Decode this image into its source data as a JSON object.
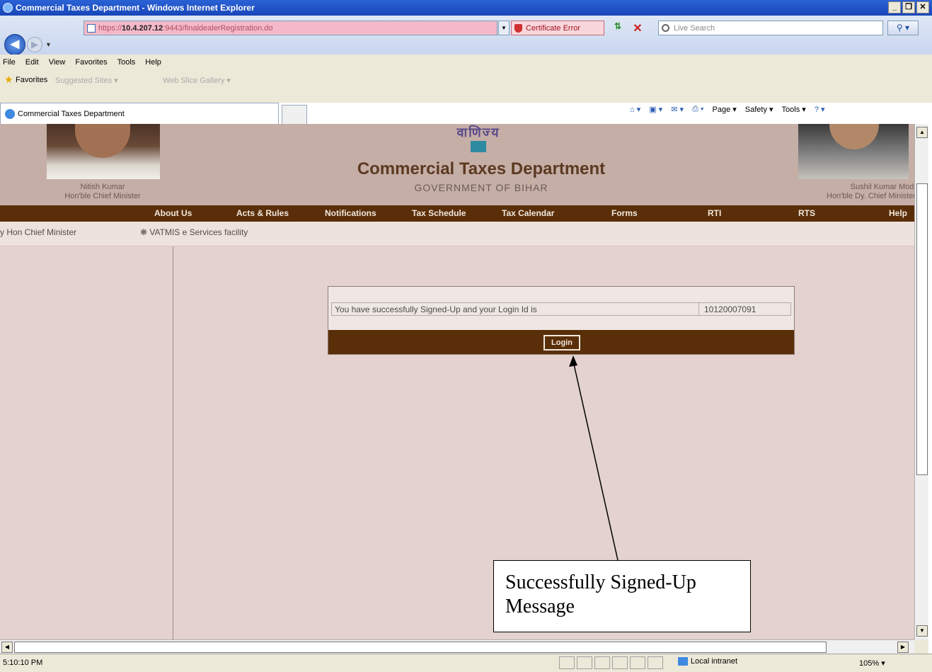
{
  "window": {
    "title": "Commercial Taxes Department - Windows Internet Explorer",
    "minimize": "_",
    "maximize": "❐",
    "close": "✕"
  },
  "address": {
    "url_prefix": "https://",
    "url_host": "10.4.207.12",
    "url_rest": ":9443/finaldealerRegistration.do",
    "cert_error": "Certificate Error",
    "search_placeholder": "Live Search"
  },
  "menu": [
    "File",
    "Edit",
    "View",
    "Favorites",
    "Tools",
    "Help"
  ],
  "favorites": {
    "label": "Favorites",
    "item1": "Suggested Sites ▾",
    "item2": "Web Slice Gallery ▾"
  },
  "tab": {
    "label": "Commercial Taxes Department"
  },
  "command_bar": [
    "Page ▾",
    "Safety ▾",
    "Tools ▾"
  ],
  "header": {
    "title": "Commercial Taxes Department",
    "subtitle": "GOVERNMENT OF BIHAR",
    "logo_text": "वाणिज्य",
    "cm_name": "Nitish Kumar",
    "cm_role": "Hon'ble Chief Minister",
    "dcm_name": "Sushil Kumar Modi",
    "dcm_role": "Hon'ble Dy. Chief Minister"
  },
  "nav": [
    "About Us",
    "Acts & Rules",
    "Notifications",
    "Tax Schedule",
    "Tax Calendar",
    "Forms",
    "RTI",
    "RTS",
    "Help"
  ],
  "marquee": {
    "item1": "y Hon Chief Minister",
    "item2": "❋ VATMIS e Services facility"
  },
  "message": {
    "text": "You have successfully Signed-Up and your Login Id is",
    "login_id": "10120007091",
    "button": "Login"
  },
  "callout": {
    "text": "Successfully Signed-Up Message"
  },
  "status": {
    "time": "5:10:10 PM",
    "zone": "Local intranet",
    "zoom": "105% ▾"
  }
}
